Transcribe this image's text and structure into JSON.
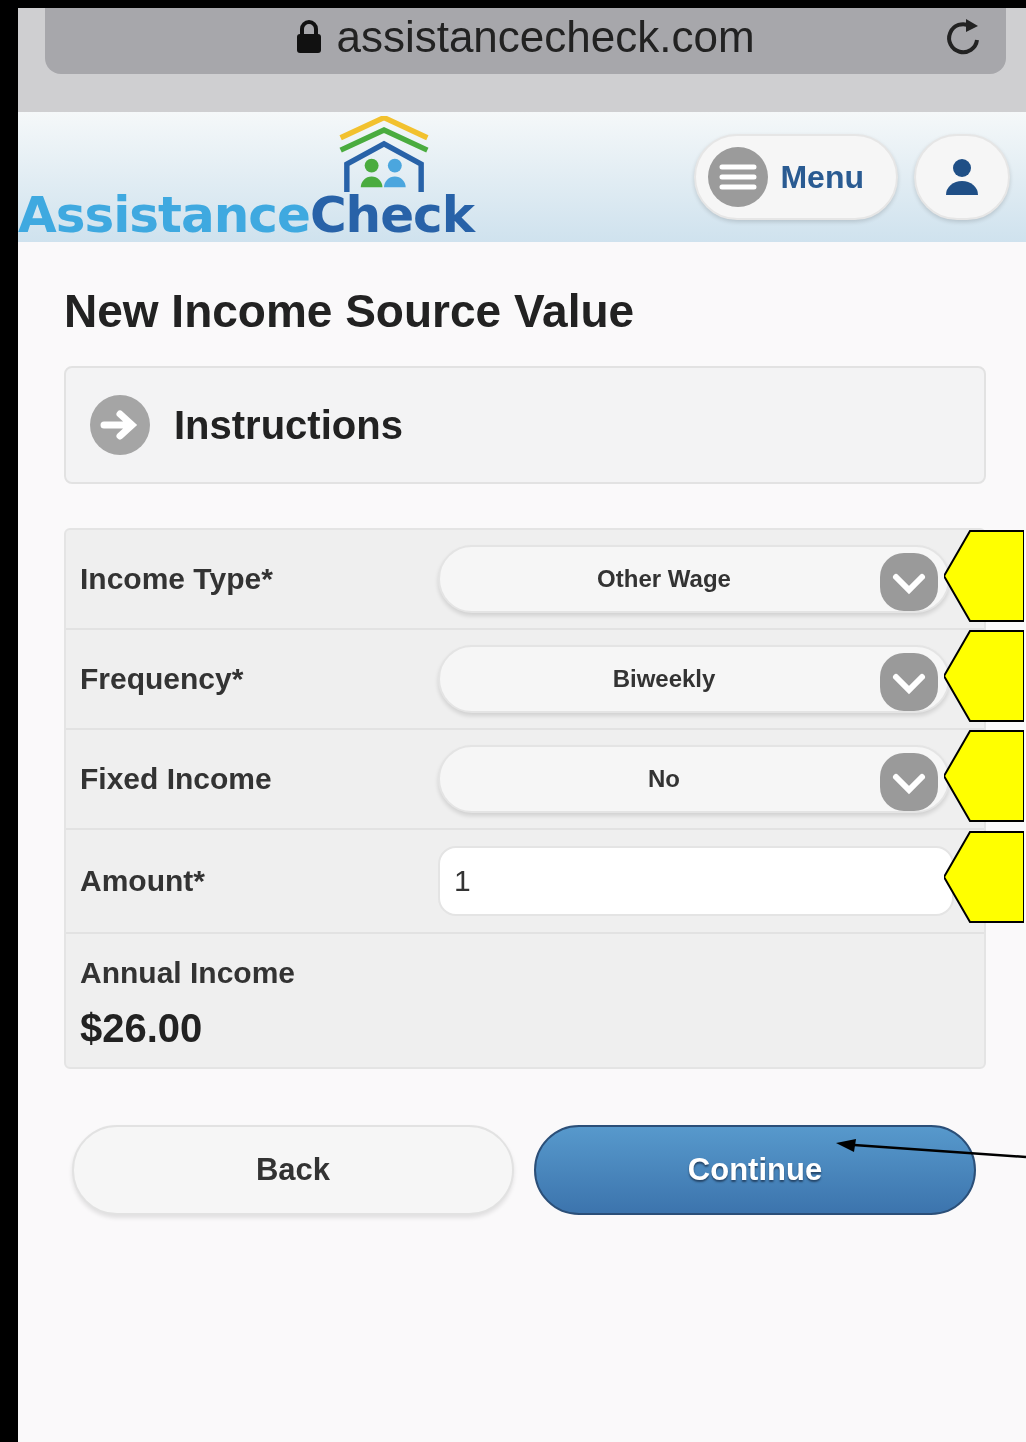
{
  "browser": {
    "url": "assistancecheck.com"
  },
  "header": {
    "logo": {
      "first": "Assistance",
      "second": "Check"
    },
    "menu_button": "Menu"
  },
  "title": "New Income Source Value",
  "instructions": {
    "label": "Instructions",
    "expanded": false
  },
  "fields": [
    {
      "kind": "select",
      "label": "Income Type*",
      "value": "Other Wage",
      "highlighted": true
    },
    {
      "kind": "select",
      "label": "Frequency*",
      "value": "Biweekly",
      "highlighted": true
    },
    {
      "kind": "select",
      "label": "Fixed Income",
      "value": "No",
      "highlighted": true
    },
    {
      "kind": "input",
      "label": "Amount*",
      "value": "1",
      "highlighted": true
    }
  ],
  "annual_income": {
    "label": "Annual Income",
    "value": "$26.00"
  },
  "buttons": [
    {
      "kind": "secondary",
      "label": "Back"
    },
    {
      "kind": "primary",
      "label": "Continue"
    }
  ]
}
